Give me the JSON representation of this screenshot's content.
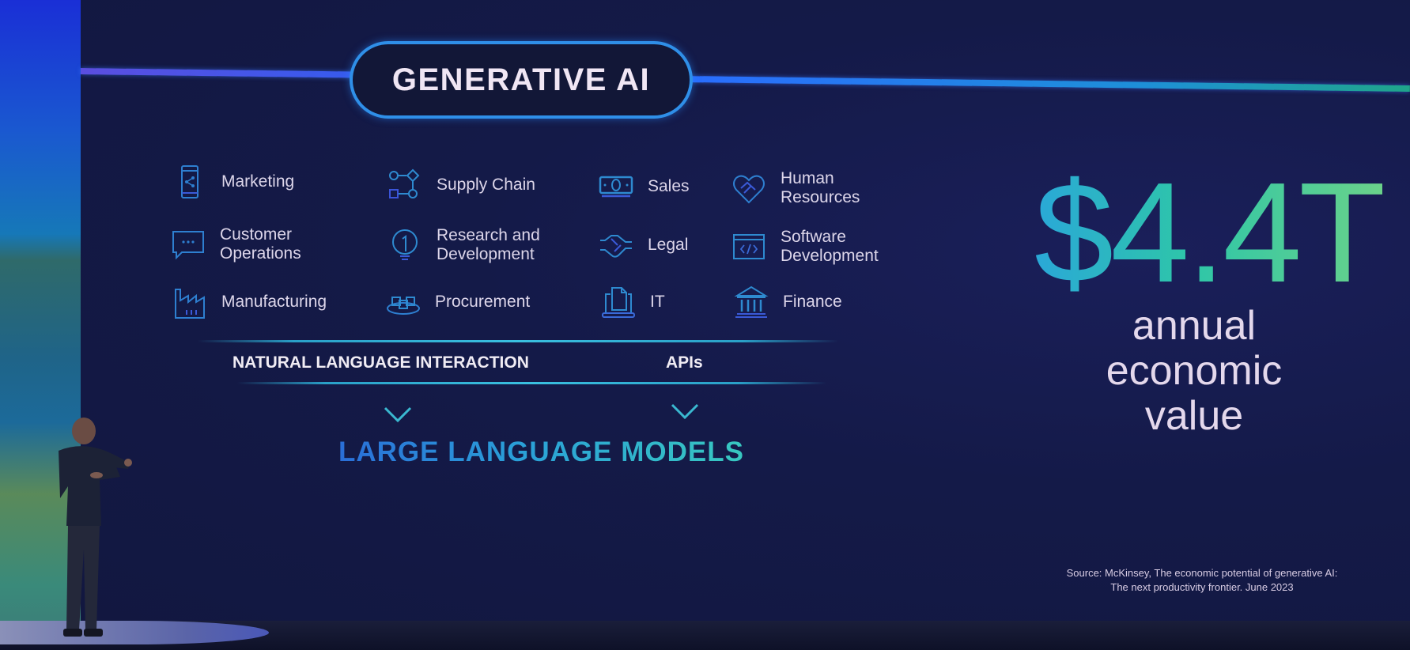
{
  "slide": {
    "title": "GENERATIVE AI",
    "use_cases": [
      {
        "label": "Marketing",
        "icon": "smartphone-share-icon"
      },
      {
        "label": "Supply Chain",
        "icon": "flow-nodes-icon"
      },
      {
        "label": "Sales",
        "icon": "banknote-icon"
      },
      {
        "label": "Human\nResources",
        "icon": "heart-handshake-icon"
      },
      {
        "label": "Customer\nOperations",
        "icon": "chat-bubble-icon"
      },
      {
        "label": "Research and\nDevelopment",
        "icon": "lightbulb-icon"
      },
      {
        "label": "Legal",
        "icon": "handshake-icon"
      },
      {
        "label": "Software\nDevelopment",
        "icon": "code-window-icon"
      },
      {
        "label": "Manufacturing",
        "icon": "factory-icon"
      },
      {
        "label": "Procurement",
        "icon": "boxes-platform-icon"
      },
      {
        "label": "IT",
        "icon": "laptop-document-icon"
      },
      {
        "label": "Finance",
        "icon": "bank-building-icon"
      }
    ],
    "interfaces": {
      "left": "NATURAL LANGUAGE INTERACTION",
      "right": "APIs"
    },
    "foundation": "LARGE LANGUAGE MODELS",
    "stat": {
      "value": "$4.4T",
      "caption_lines": [
        "annual",
        "economic",
        "value"
      ]
    },
    "source": {
      "line1": "Source: McKinsey, The economic potential of generative AI:",
      "line2": "The next productivity frontier. June 2023"
    },
    "colors": {
      "accent_blue": "#2f8fe8",
      "accent_teal": "#2ec6a8",
      "background": "#141a48"
    }
  }
}
